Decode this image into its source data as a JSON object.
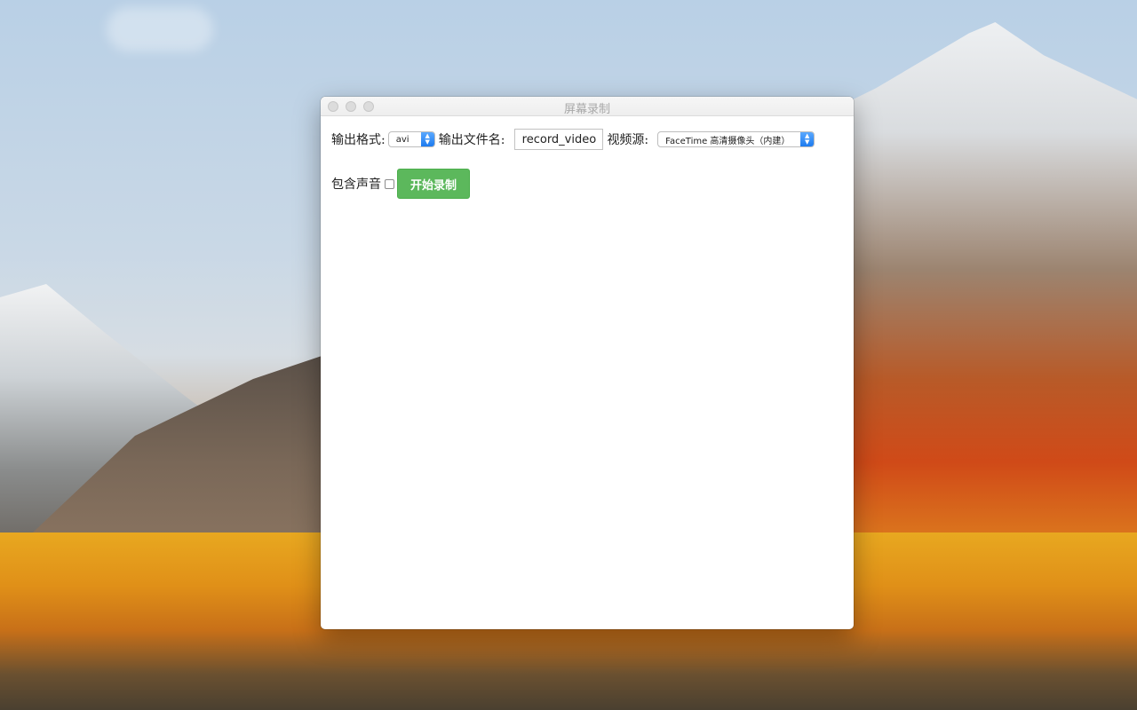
{
  "window": {
    "title": "屏幕录制"
  },
  "form": {
    "format_label": "输出格式:",
    "format_value": "avi",
    "filename_label": "输出文件名:",
    "filename_value": "record_video",
    "source_label": "视频源:",
    "source_value": "FaceTime 高清摄像头（内建）",
    "audio_label": "包含声音",
    "audio_checked": false,
    "start_button": "开始录制"
  },
  "colors": {
    "start_button_bg": "#5cb85c",
    "select_arrow_accent": "#1d7bef"
  },
  "icons": {
    "select_arrows": "up-down-chevron-icon",
    "traffic_lights": [
      "close-icon",
      "minimize-icon",
      "zoom-icon"
    ]
  }
}
